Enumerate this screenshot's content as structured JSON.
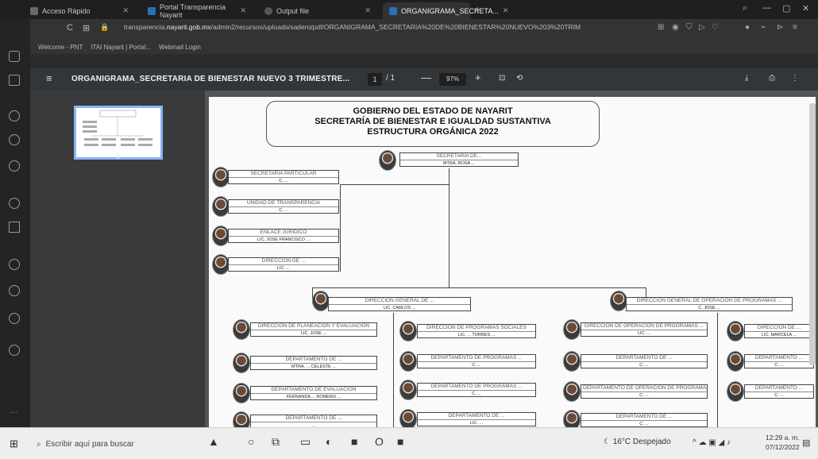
{
  "browser": {
    "tabs": [
      {
        "label": "Acceso Rápido",
        "color": "#6a6a6a"
      },
      {
        "label": "Portal Transparencia Nayarit",
        "color": "#2d6fb5"
      },
      {
        "label": "Output file",
        "color": "#555555"
      },
      {
        "label": "ORGANIGRAMA_SECRETA...",
        "color": "#2d6fb5",
        "active": true
      }
    ],
    "url_prefix": "transparencia.",
    "url_domain": "nayarit.gob.mx",
    "url_rest": "/admin2/recursos/uploads/sadero/pdf/ORGANIGRAMA_SECRETARIA%20DE%20BIENESTAR%20NUEVO%203%20TRIM",
    "bookmarks": [
      "Welcome - PNT",
      "ITAI Nayarit | Portal...",
      "Webmail Login"
    ]
  },
  "pdf": {
    "title": "ORGANIGRAMA_SECRETARIA DE BIENESTAR NUEVO 3 TRIMESTRE...",
    "page_current": "1",
    "page_total": "/ 1",
    "zoom": "97%",
    "thumb_page": "1"
  },
  "chart": {
    "header_lines": [
      "GOBIERNO DEL ESTADO DE NAYARIT",
      "SECRETARÍA DE BIENESTAR E IGUALDAD SUSTANTIVA",
      "ESTRUCTURA ORGÁNICA 2022"
    ],
    "top": {
      "title": "SECRETARIA DE...",
      "name": "MTRA. ROSA ..."
    },
    "left_units": [
      {
        "title": "SECRETARIA PARTICULAR",
        "name": "C. ..."
      },
      {
        "title": "UNIDAD DE TRANSPARENCIA",
        "name": "C. ..."
      },
      {
        "title": "ENLACE JURIDICO",
        "name": "LIC. JOSE FRANCISCO ..."
      },
      {
        "title": "DIRECCION DE ...",
        "name": "LIC. ..."
      }
    ],
    "dir_left": {
      "title": "DIRECCION GENERAL DE ...",
      "name": "LIC. CARLOS ..."
    },
    "dir_right": {
      "title": "DIRECCION GENERAL DE OPERACION DE PROGRAMAS ...",
      "name": "C. JOSE ..."
    },
    "col1": [
      {
        "title": "DIRECCION DE PLANEACION Y EVALUACION",
        "name": "LIC. JOSE ..."
      },
      {
        "title": "DEPARTAMENTO DE ...",
        "name": "MTRA. ... CELESTE ..."
      },
      {
        "title": "DEPARTAMENTO DE EVALUACION",
        "name": "FERNANDA ... ROMERO ..."
      },
      {
        "title": "DEPARTAMENTO DE ...",
        "name": "..."
      }
    ],
    "col2": [
      {
        "title": "DIRECCION DE PROGRAMAS SOCIALES",
        "name": "LIC. ... TORRES ..."
      },
      {
        "title": "DEPARTAMENTO DE PROGRAMAS ...",
        "name": "C. ..."
      },
      {
        "title": "DEPARTAMENTO DE PROGRAMAS ...",
        "name": "C. ..."
      },
      {
        "title": "DEPARTAMENTO DE ...",
        "name": "LIC. ..."
      }
    ],
    "col3": [
      {
        "title": "DIRECCION DE OPERACION DE PROGRAMAS ...",
        "name": "LIC. ..."
      },
      {
        "title": "DEPARTAMENTO DE ...",
        "name": "C. ..."
      },
      {
        "title": "DEPARTAMENTO DE OPERACION DE PROGRAMAS",
        "name": "C. ..."
      },
      {
        "title": "DEPARTAMENTO DE ...",
        "name": "C. ..."
      }
    ],
    "col4": [
      {
        "title": "DIRECCION DE ...",
        "name": "LIC. MARCELA ..."
      },
      {
        "title": "DEPARTAMENTO ...",
        "name": "C. ..."
      },
      {
        "title": "DEPARTAMENTO ...",
        "name": "C. ..."
      }
    ]
  },
  "taskbar": {
    "search_placeholder": "Escribir aquí para buscar",
    "weather": "16°C Despejado",
    "time": "12:29 a. m.",
    "date": "07/12/2022"
  }
}
